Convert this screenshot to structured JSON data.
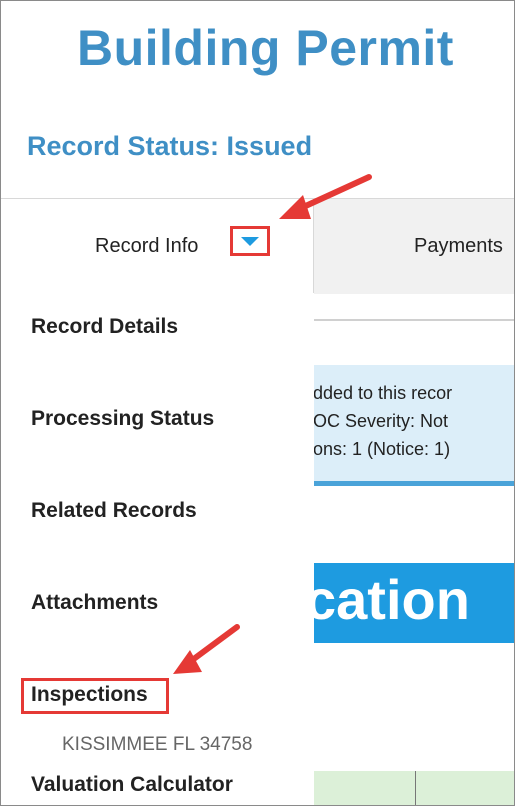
{
  "header": {
    "title": "Building Permit",
    "record_status": "Record Status: Issued"
  },
  "tabs": {
    "record_info": "Record Info",
    "payments": "Payments"
  },
  "menu": {
    "items": [
      "Record Details",
      "Processing Status",
      "Related Records",
      "Attachments",
      "Inspections"
    ],
    "address": "KISSIMMEE FL 34758",
    "valuation": "Valuation Calculator"
  },
  "notice": {
    "line1": "dded to this recor",
    "line2": "OC   Severity:  Not",
    "line3": "ons: 1  (Notice: 1)"
  },
  "banner": {
    "text": "cation"
  },
  "colors": {
    "accent_blue": "#3f8fc5",
    "banner_blue": "#1e9be0",
    "highlight_red": "#e53935"
  }
}
